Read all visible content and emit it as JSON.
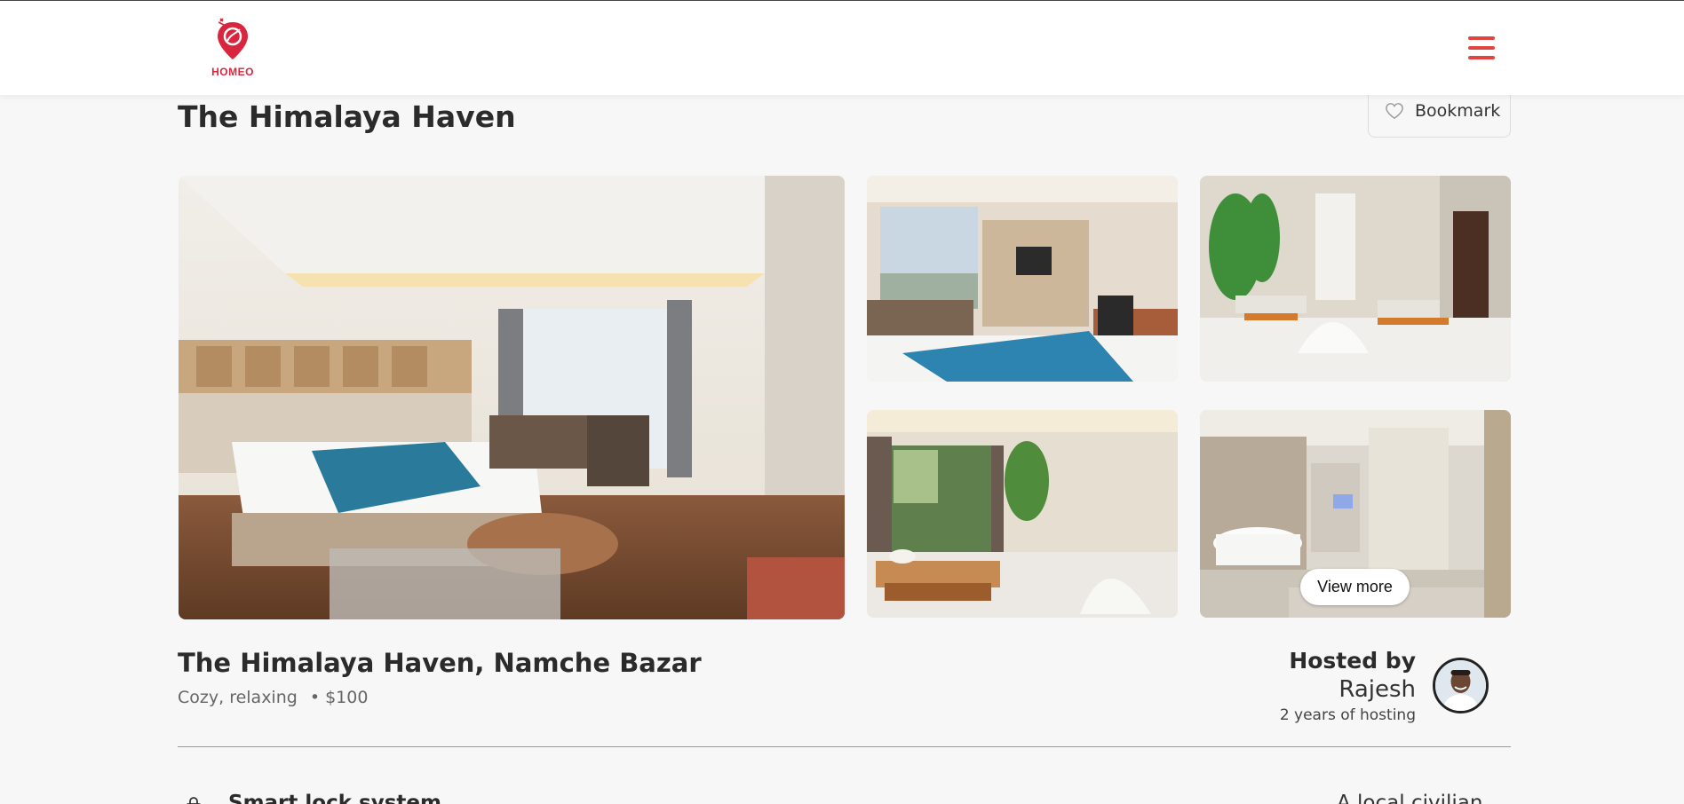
{
  "header": {
    "brand": "HOMEO",
    "accent_color": "#e2443f",
    "menu_icon": "hamburger-menu-icon"
  },
  "listing": {
    "title": "The Himalaya Haven",
    "bookmark_label": "Bookmark",
    "bookmark_icon": "heart-outline-icon",
    "full_name": "The Himalaya Haven, Namche Bazar",
    "tags": "Cozy, relaxing",
    "price": "• $100"
  },
  "gallery": {
    "photos": [
      "bedroom-main",
      "living-room",
      "spa-room-plants",
      "massage-room-window",
      "bathroom-tub"
    ],
    "view_more_label": "View more"
  },
  "host": {
    "label": "Hosted by",
    "name": "Rajesh",
    "experience": "2 years of hosting"
  },
  "amenities": {
    "left_item": "Smart lock system",
    "right_item": "A local civilian"
  }
}
